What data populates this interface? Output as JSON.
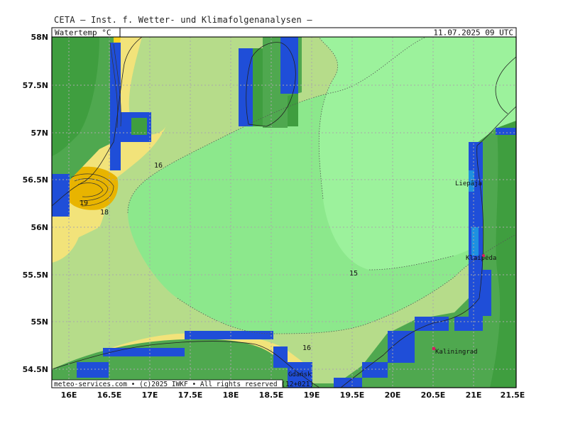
{
  "header": {
    "title": "CETA — Inst. f. Wetter- und Klimafolgenanalysen —"
  },
  "panel": {
    "variable": "Watertemp °C",
    "datetime": "11.07.2025 09 UTC"
  },
  "footer": {
    "credit": "meteo-services.com • (c)2025 IWKF • All rights reserved (12+021)"
  },
  "axes": {
    "lat_labels": [
      "58N",
      "57.5N",
      "57N",
      "56.5N",
      "56N",
      "55.5N",
      "55N",
      "54.5N"
    ],
    "lon_labels": [
      "16E",
      "16.5E",
      "17E",
      "17.5E",
      "18E",
      "18.5E",
      "19E",
      "19.5E",
      "20E",
      "20.5E",
      "21E",
      "21.5E"
    ]
  },
  "contour_labels": {
    "c16a": "16",
    "c19": "19",
    "c18": "18",
    "c15": "15",
    "c16b": "16"
  },
  "cities": {
    "liepaja": "Liepāja",
    "klaipeda": "Klaipėda",
    "kaliningrad": "Kaliningrad",
    "gdansk": "Gdańsk"
  },
  "colors": {
    "temp_15": "#9cf29c",
    "temp_15_5": "#8ce88c",
    "temp_16": "#b6dc8a",
    "temp_17": "#cfe07a",
    "temp_18": "#f2e37a",
    "temp_19": "#f7d21f",
    "temp_20": "#e8b400",
    "land_dark": "#4fa84f",
    "land_mid": "#3f9e3f",
    "coast_blue": "#1f4ed8",
    "coast_cyan": "#1e90e0"
  }
}
